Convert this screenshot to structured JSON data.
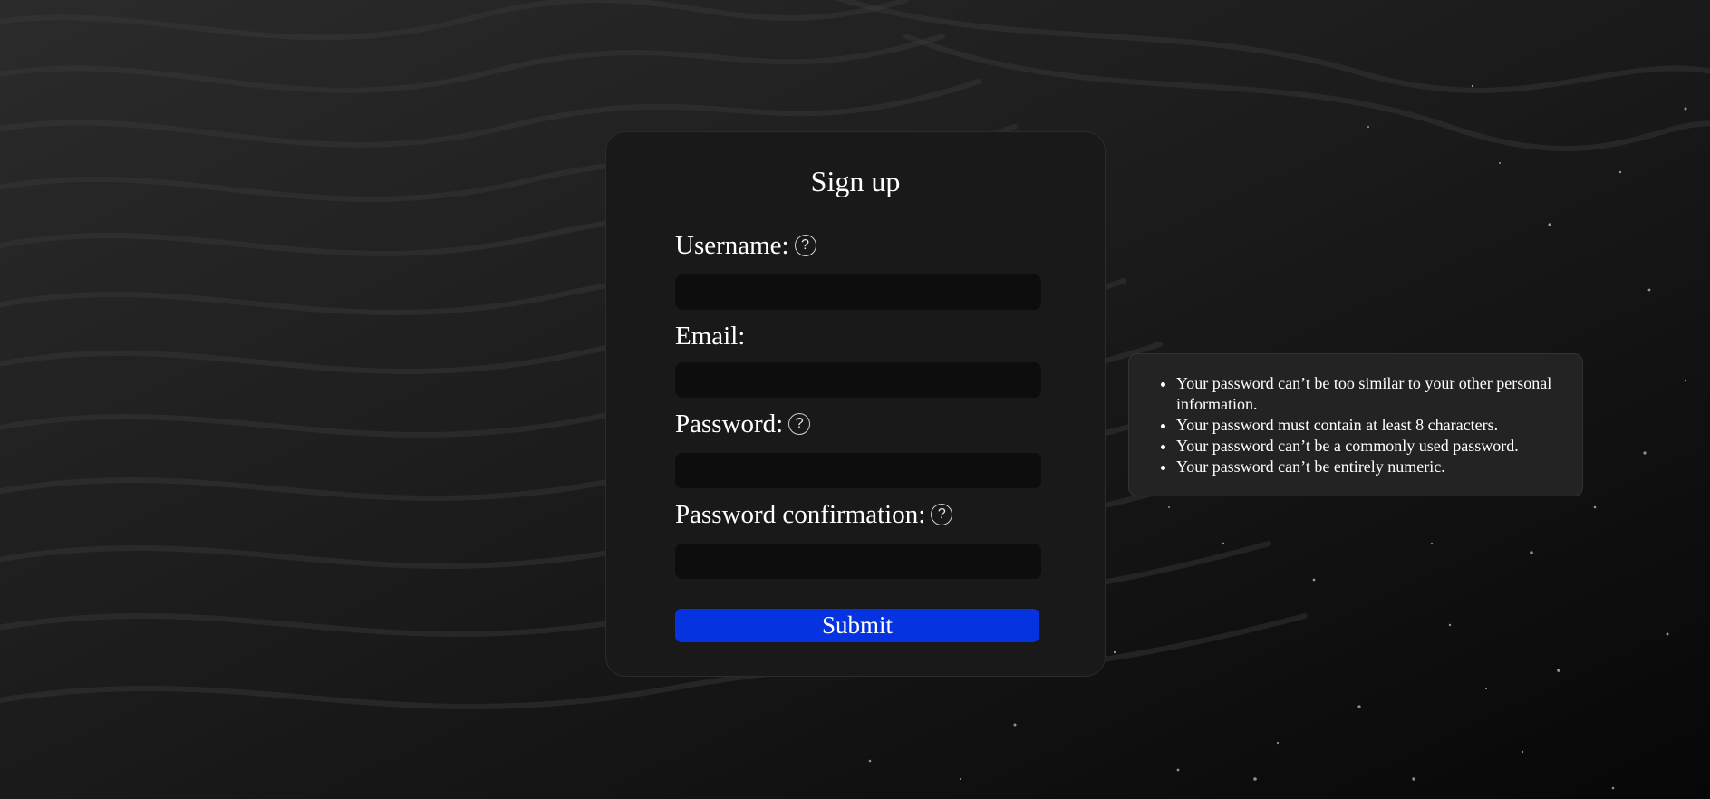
{
  "form": {
    "title": "Sign up",
    "username_label": "Username:",
    "email_label": "Email:",
    "password_label": "Password:",
    "password_confirmation_label": "Password confirmation:",
    "username_value": "",
    "email_value": "",
    "password_value": "",
    "password_confirmation_value": "",
    "help_icon_glyph": "?",
    "submit_label": "Submit"
  },
  "password_help": {
    "items": [
      "Your password can’t be too similar to your other personal information.",
      "Your password must contain at least 8 characters.",
      "Your password can’t be a commonly used password.",
      "Your password can’t be entirely numeric."
    ]
  },
  "theme": {
    "card_background": "#191919",
    "input_background": "#0d0d0d",
    "submit_color": "#0433df",
    "panel_background": "#232323"
  },
  "icons": {
    "help": "question-circle-icon"
  }
}
